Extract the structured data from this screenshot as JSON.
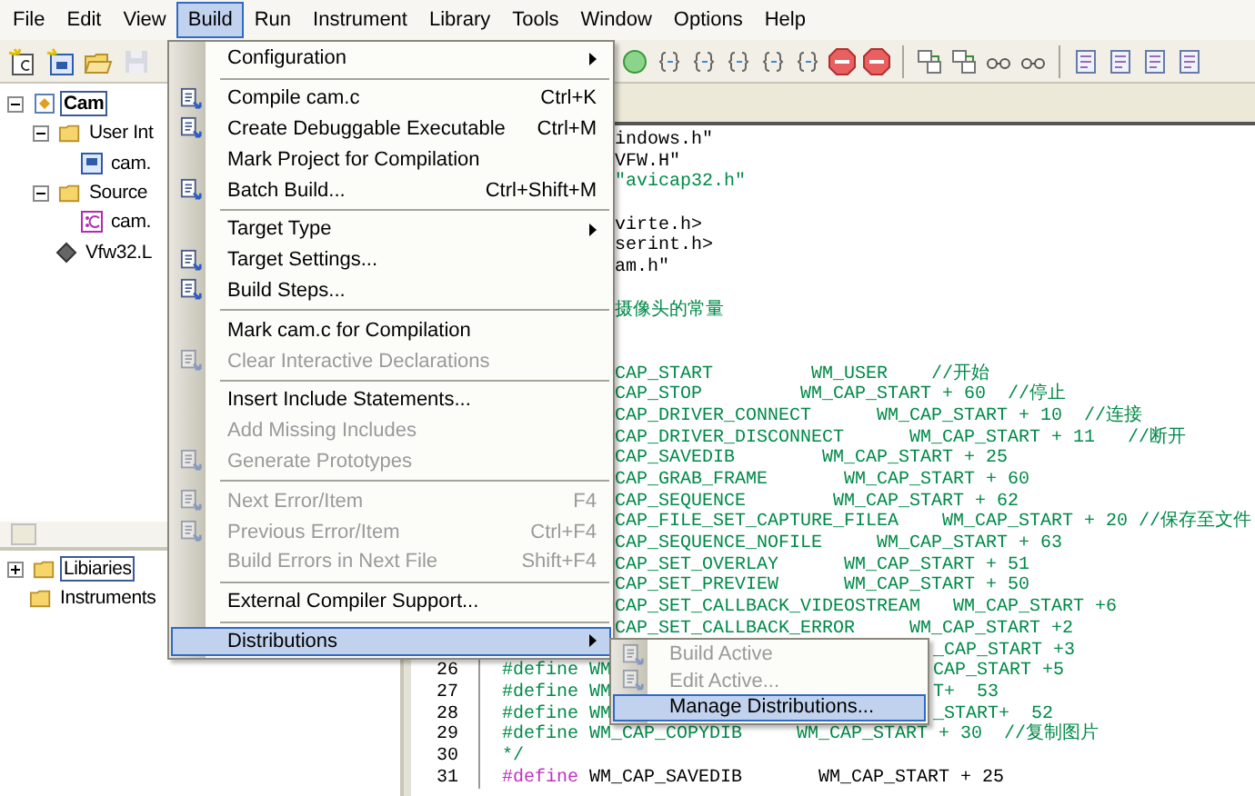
{
  "menubar": [
    {
      "label": "File",
      "selected": false
    },
    {
      "label": "Edit",
      "selected": false
    },
    {
      "label": "View",
      "selected": false
    },
    {
      "label": "Build",
      "selected": true
    },
    {
      "label": "Run",
      "selected": false
    },
    {
      "label": "Instrument",
      "selected": false
    },
    {
      "label": "Library",
      "selected": false
    },
    {
      "label": "Tools",
      "selected": false
    },
    {
      "label": "Window",
      "selected": false
    },
    {
      "label": "Options",
      "selected": false
    },
    {
      "label": "Help",
      "selected": false
    }
  ],
  "project_tree": [
    {
      "kind": "project",
      "label": "Cam",
      "selected": true,
      "expanded": true,
      "children": [
        {
          "kind": "folder",
          "label": "User Int",
          "selected": false,
          "expanded": true,
          "children": [
            {
              "kind": "uir",
              "label": "cam.",
              "selected": false
            }
          ]
        },
        {
          "kind": "folder",
          "label": "Source",
          "selected": false,
          "expanded": true,
          "children": [
            {
              "kind": "cfile",
              "label": "cam.",
              "selected": false
            }
          ]
        },
        {
          "kind": "library",
          "label": "Vfw32.L",
          "selected": false
        }
      ]
    }
  ],
  "library_tree": [
    {
      "kind": "folder",
      "label": "Libiaries",
      "selected": true,
      "expanded": false
    },
    {
      "kind": "folder",
      "label": "Instruments",
      "selected": false
    }
  ],
  "editor": {
    "lines": [
      {
        "kind": "covered",
        "parts": [
          {
            "text": "indows.h\"",
            "kind": "plain"
          }
        ]
      },
      {
        "kind": "covered",
        "parts": [
          {
            "text": "VFW.H\"",
            "kind": "plain"
          }
        ]
      },
      {
        "kind": "covered",
        "parts": [
          {
            "text": "\"avicap32.h\"",
            "kind": "comment"
          }
        ]
      },
      {
        "kind": "blank"
      },
      {
        "kind": "covered",
        "parts": [
          {
            "text": "virte.h>",
            "kind": "plain"
          }
        ]
      },
      {
        "kind": "covered",
        "parts": [
          {
            "text": "serint.h>",
            "kind": "plain"
          }
        ]
      },
      {
        "kind": "covered",
        "parts": [
          {
            "text": "am.h\"",
            "kind": "plain"
          }
        ]
      },
      {
        "kind": "blank"
      },
      {
        "kind": "covered",
        "parts": [
          {
            "text": "摄像头的常量",
            "kind": "comment"
          }
        ]
      },
      {
        "kind": "blank"
      },
      {
        "kind": "blank"
      },
      {
        "kind": "covered",
        "parts": [
          {
            "text": "CAP_START         WM_USER    //开始",
            "kind": "comment"
          }
        ]
      },
      {
        "kind": "covered",
        "parts": [
          {
            "text": "CAP_STOP         WM_CAP_START + 60  //停止",
            "kind": "comment"
          }
        ]
      },
      {
        "kind": "covered",
        "parts": [
          {
            "text": "CAP_DRIVER_CONNECT      WM_CAP_START + 10  //连接",
            "kind": "comment"
          }
        ]
      },
      {
        "kind": "covered",
        "parts": [
          {
            "text": "CAP_DRIVER_DISCONNECT      WM_CAP_START + 11   //断开",
            "kind": "comment"
          }
        ]
      },
      {
        "kind": "covered",
        "parts": [
          {
            "text": "CAP_SAVEDIB        WM_CAP_START + 25",
            "kind": "comment"
          }
        ]
      },
      {
        "kind": "covered",
        "parts": [
          {
            "text": "CAP_GRAB_FRAME       WM_CAP_START + 60",
            "kind": "comment"
          }
        ]
      },
      {
        "kind": "covered",
        "parts": [
          {
            "text": "CAP_SEQUENCE        WM_CAP_START + 62",
            "kind": "comment"
          }
        ]
      },
      {
        "kind": "covered",
        "parts": [
          {
            "text": "CAP_FILE_SET_CAPTURE_FILEA    WM_CAP_START + 20 //保存至文件",
            "kind": "comment"
          }
        ]
      },
      {
        "kind": "covered",
        "parts": [
          {
            "text": "CAP_SEQUENCE_NOFILE     WM_CAP_START + 63",
            "kind": "comment"
          }
        ]
      },
      {
        "kind": "covered",
        "parts": [
          {
            "text": "CAP_SET_OVERLAY      WM_CAP_START + 51",
            "kind": "comment"
          }
        ]
      },
      {
        "kind": "covered",
        "parts": [
          {
            "text": "CAP_SET_PREVIEW      WM_CAP_START + 50",
            "kind": "comment"
          }
        ]
      },
      {
        "kind": "covered",
        "parts": [
          {
            "text": "CAP_SET_CALLBACK_VIDEOSTREAM   WM_CAP_START +6",
            "kind": "comment"
          }
        ]
      },
      {
        "kind": "covered",
        "parts": [
          {
            "text": "CAP_SET_CALLBACK_ERROR     WM_CAP_START +2",
            "kind": "comment"
          }
        ]
      },
      {
        "kind": "split",
        "right": {
          "text": "_CAP_START +3",
          "kind": "comment"
        }
      },
      {
        "kind": "split",
        "number": "26",
        "left": {
          "text": "#define WM",
          "kind": "comment"
        },
        "right": {
          "text": "CAP_START +5",
          "kind": "comment"
        }
      },
      {
        "kind": "split",
        "number": "27",
        "left": {
          "text": "#define WM",
          "kind": "comment"
        },
        "right": {
          "text": "T+  53",
          "kind": "comment"
        }
      },
      {
        "kind": "split",
        "number": "28",
        "left": {
          "text": "#define WM",
          "kind": "comment"
        },
        "right": {
          "text": "_START+  52",
          "kind": "comment"
        }
      },
      {
        "kind": "full",
        "number": "29",
        "parts": [
          {
            "text": "#define WM_CAP_COPYDIB     WM_CAP_START + 30  //复制图片",
            "kind": "comment"
          }
        ]
      },
      {
        "kind": "full",
        "number": "30",
        "parts": [
          {
            "text": "*/",
            "kind": "comment"
          }
        ]
      },
      {
        "kind": "full",
        "number": "31",
        "parts": [
          {
            "text": "#define",
            "kind": "directive"
          },
          {
            "text": " WM_CAP_SAVEDIB       WM_CAP_START + 25",
            "kind": "plain"
          }
        ]
      }
    ]
  },
  "build_menu": {
    "items": [
      {
        "kind": "item",
        "label": "Configuration",
        "submenu": true,
        "icon": false,
        "disabled": false,
        "selected": false
      },
      {
        "kind": "separator"
      },
      {
        "kind": "item",
        "label": "Compile cam.c",
        "shortcut": "Ctrl+K",
        "icon": true,
        "disabled": false,
        "selected": false
      },
      {
        "kind": "item",
        "label": "Create Debuggable Executable",
        "shortcut": "Ctrl+M",
        "icon": true,
        "disabled": false,
        "selected": false
      },
      {
        "kind": "item",
        "label": "Mark Project for Compilation",
        "icon": false,
        "disabled": false,
        "selected": false
      },
      {
        "kind": "item",
        "label": "Batch Build...",
        "shortcut": "Ctrl+Shift+M",
        "icon": true,
        "disabled": false,
        "selected": false
      },
      {
        "kind": "separator"
      },
      {
        "kind": "item",
        "label": "Target Type",
        "submenu": true,
        "icon": false,
        "disabled": false,
        "selected": false
      },
      {
        "kind": "item",
        "label": "Target Settings...",
        "icon": true,
        "disabled": false,
        "selected": false
      },
      {
        "kind": "item",
        "label": "Build Steps...",
        "icon": true,
        "disabled": false,
        "selected": false
      },
      {
        "kind": "separator"
      },
      {
        "kind": "item",
        "label": "Mark cam.c for Compilation",
        "icon": false,
        "disabled": false,
        "selected": false
      },
      {
        "kind": "item",
        "label": "Clear Interactive Declarations",
        "icon": true,
        "disabled": true,
        "selected": false
      },
      {
        "kind": "separator"
      },
      {
        "kind": "item",
        "label": "Insert Include Statements...",
        "icon": false,
        "disabled": false,
        "selected": false
      },
      {
        "kind": "item",
        "label": "Add Missing Includes",
        "icon": false,
        "disabled": true,
        "selected": false
      },
      {
        "kind": "item",
        "label": "Generate Prototypes",
        "icon": true,
        "disabled": true,
        "selected": false
      },
      {
        "kind": "separator"
      },
      {
        "kind": "item",
        "label": "Next Error/Item",
        "shortcut": "F4",
        "icon": true,
        "disabled": true,
        "selected": false
      },
      {
        "kind": "item",
        "label": "Previous Error/Item",
        "shortcut": "Ctrl+F4",
        "icon": true,
        "disabled": true,
        "selected": false
      },
      {
        "kind": "item",
        "label": "Build Errors in Next File",
        "shortcut": "Shift+F4",
        "icon": false,
        "disabled": true,
        "selected": false
      },
      {
        "kind": "separator"
      },
      {
        "kind": "item",
        "label": "External Compiler Support...",
        "icon": false,
        "disabled": false,
        "selected": false
      },
      {
        "kind": "separator"
      },
      {
        "kind": "item",
        "label": "Distributions",
        "submenu": true,
        "icon": false,
        "disabled": false,
        "selected": true
      }
    ]
  },
  "distributions_menu": {
    "items": [
      {
        "kind": "item",
        "label": "Build Active",
        "icon": true,
        "disabled": true,
        "selected": false
      },
      {
        "kind": "item",
        "label": "Edit Active...",
        "icon": true,
        "disabled": true,
        "selected": false
      },
      {
        "kind": "item",
        "label": "Manage Distributions...",
        "icon": false,
        "disabled": false,
        "selected": true
      }
    ]
  }
}
